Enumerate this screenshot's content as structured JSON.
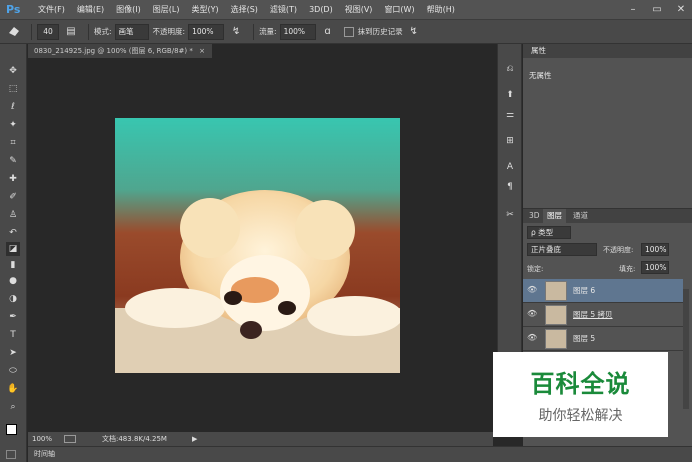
{
  "app": {
    "logo": "Ps"
  },
  "menu": [
    "文件(F)",
    "编辑(E)",
    "图像(I)",
    "图层(L)",
    "类型(Y)",
    "选择(S)",
    "滤镜(T)",
    "3D(D)",
    "视图(V)",
    "窗口(W)",
    "帮助(H)"
  ],
  "window_controls": {
    "minimize": "–",
    "restore": "▭",
    "close": "✕"
  },
  "options": {
    "brush_size": "40",
    "mode_label": "模式:",
    "mode_value": "画笔",
    "opacity_label": "不透明度:",
    "opacity_value": "100%",
    "flow_label": "流量:",
    "flow_value": "100%",
    "history_label": "抹到历史记录"
  },
  "document": {
    "tab": "0830_214925.jpg @ 100% (图层 6, RGB/8#) *",
    "close": "×"
  },
  "status": {
    "zoom": "100%",
    "doc_size": "文档:483.8K/4.25M"
  },
  "timeline": {
    "label": "时间轴"
  },
  "properties": {
    "tab": "属性",
    "content": "无属性"
  },
  "layers_panel": {
    "tabs": [
      "3D",
      "图层",
      "通道"
    ],
    "filter_label": "ρ 类型",
    "blend_mode": "正片叠底",
    "opacity_label": "不透明度:",
    "opacity_value": "100%",
    "lock_label": "锁定:",
    "fill_label": "填充:",
    "fill_value": "100%",
    "layers": [
      {
        "name": "图层 6",
        "selected": true
      },
      {
        "name": "图层 5 拷贝",
        "selected": false
      },
      {
        "name": "图层 5",
        "selected": false
      }
    ]
  },
  "watermark": {
    "title": "百科全说",
    "subtitle": "助你轻松解决"
  },
  "colors": {
    "accent_selected": "#5f7690",
    "watermark_green": "#1a8a3a"
  }
}
